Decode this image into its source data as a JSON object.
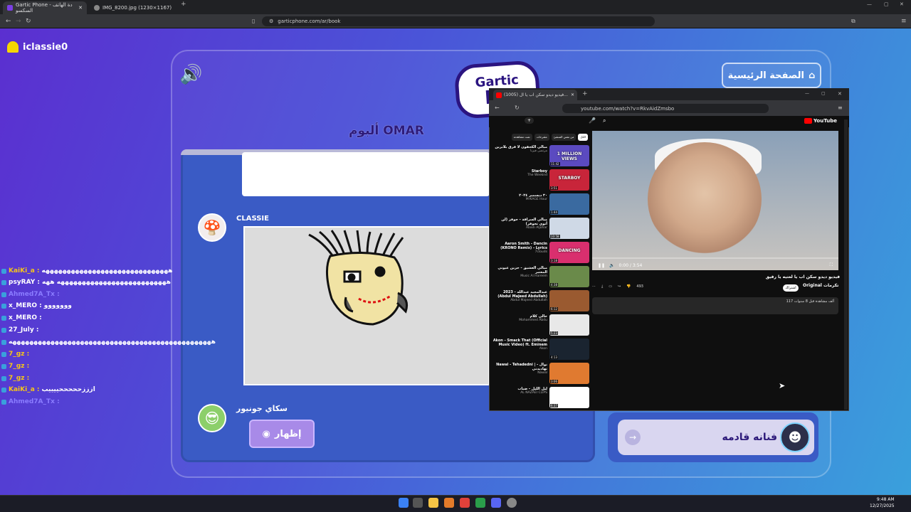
{
  "browser": {
    "tabs": [
      {
        "label": "Gartic Phone - دة الهاتف السكسو"
      },
      {
        "label": "IMG_8200.jpg (1230×1167)"
      }
    ],
    "url": "garticphone.com/ar/book"
  },
  "game": {
    "username": "iclassie0",
    "home_button": "الصفحة الرئيسية",
    "logo_text": "Gartic",
    "logo_text2": "Ph",
    "album_title": "ألبوم OMAR",
    "player1": "CLASSIE",
    "player2": "سكاي جونيور",
    "show_button": "إظهار",
    "next_button": "فنانه قادمه"
  },
  "chat": [
    {
      "name": "KaiKi_a",
      "msg": "ههههههههههههههههههههههههههههههه",
      "color": "#f5c518"
    },
    {
      "name": "psyRAY",
      "msg": "ههههههههههههههههههههههههههه ههه",
      "color": "#ffffff"
    },
    {
      "name": "Ahmed7A_Tx",
      "msg": "",
      "color": "#8a7cff"
    },
    {
      "name": "x_MERO",
      "msg": "ووووووو",
      "color": "#ffffff"
    },
    {
      "name": "x_MERO",
      "msg": "",
      "color": "#ffffff"
    },
    {
      "name": "27_July",
      "msg": "",
      "color": "#ffffff"
    },
    {
      "name": "",
      "msg": "ههههههههههههههههههههههههههههههههههههههههههههههههه",
      "color": "#ffffff"
    },
    {
      "name": "7_gz",
      "msg": "",
      "color": "#f5c518"
    },
    {
      "name": "7_gz",
      "msg": "",
      "color": "#f5c518"
    },
    {
      "name": "7_gz",
      "msg": "",
      "color": "#f5c518"
    },
    {
      "name": "KaiKi_a",
      "msg": "ازززحححححييييب",
      "color": "#f5c518"
    },
    {
      "name": "Ahmed7A_Tx",
      "msg": "",
      "color": "#8a7cff"
    }
  ],
  "youtube": {
    "tab_label": "(1005) فيديو ديدو سكن اب يا ال...",
    "url": "youtube.com/watch?v=RkvAidZmsbo",
    "brand": "YouTube",
    "time": "0:00 / 3:54",
    "video_title": "فيديو ديدو سكن اب يا لغتيه يا رفيق",
    "channel": "Original تكرمات",
    "subscribe": "اشتراك",
    "likes": "493",
    "desc": "117 ألف مشاهدة قبل 8 سنوات",
    "chips": [
      "الكل",
      "من نفس المنشئ",
      "مقترحات",
      "تمت مشاهدته"
    ],
    "related": [
      {
        "title": "مبالي الكحقون لا فرق بلابرين",
        "sub": "مرتضى فيرنا",
        "dur": "11:42",
        "color": "#5b4ac0",
        "label": "1 MILLION VIEWS"
      },
      {
        "title": "Starboy",
        "sub": "The Weeknd",
        "dur": "3:51",
        "color": "#c8253a",
        "label": "STARBOY"
      },
      {
        "title": "٣٠ ديسمبر ٢٠٢٤",
        "sub": "MrKAGE Hour",
        "dur": "1:44",
        "color": "#3a6aa0",
        "label": ""
      },
      {
        "title": "مبالي السراقة - حوفز (لن أنوي تحوفز)",
        "sub": "Abadi Aljohar",
        "dur": "10:58",
        "color": "#cfd9e6",
        "label": ""
      },
      {
        "title": "Aaron Smith - Dancin (KRONO Remix) - Lyrics",
        "sub": "7clouds",
        "dur": "3:18",
        "color": "#d92f6e",
        "label": "DANCING"
      },
      {
        "title": "مبالي العشيق - حزين عيوني المعتبر",
        "sub": "Music Al Hareem",
        "dur": "4:38",
        "color": "#6a8a4a",
        "label": ""
      },
      {
        "title": "عبدالمجيد عبدالله - 2023 (Abdul Majeed Abdullah)",
        "sub": "Abdul Majeed Abdullah",
        "dur": "6:12",
        "color": "#9a5a30",
        "label": ""
      },
      {
        "title": "حالي كلام",
        "sub": "Mohammed Abdu",
        "dur": "5:23",
        "color": "#e8e8e8",
        "label": ""
      },
      {
        "title": "Akon - Smack That (Official Music Video) ft. Eminem",
        "sub": "Akon",
        "dur": "4:13",
        "color": "#1a2430",
        "label": ""
      },
      {
        "title": "Nawal - Tehadedni | نوال - تهاديدني",
        "sub": "Nawal",
        "dur": "3:06",
        "color": "#e07a30",
        "label": ""
      },
      {
        "title": "ليل الليل - ضباب",
        "sub": "AL NAZAEI CLIPS",
        "dur": "6:37",
        "color": "#ffffff",
        "label": ""
      }
    ]
  },
  "taskbar": {
    "time": "9:48 AM",
    "date": "12/27/2025"
  },
  "colors": {
    "page_gradient_start": "#5b2fd0",
    "page_gradient_end": "#3aa0dc",
    "album_bg": "#3a5bc5",
    "accent_purple": "#2d1a7a"
  }
}
